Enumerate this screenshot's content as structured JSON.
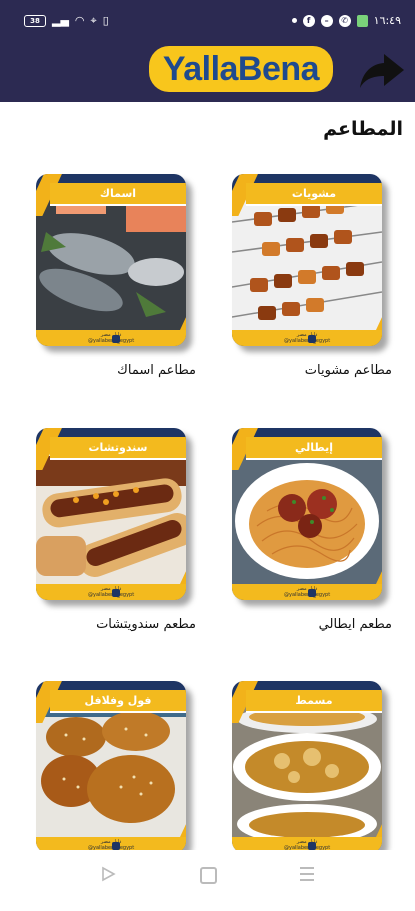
{
  "status_bar": {
    "time": "١٦:٤٩",
    "battery": "38"
  },
  "header": {
    "logo_text": "YallaBena",
    "back_icon": "share-arrow-icon"
  },
  "page": {
    "title": "المطاعم"
  },
  "cards": [
    {
      "banner": "مشويات",
      "label": "مطاعم مشويات",
      "photo": "grill"
    },
    {
      "banner": "اسماك",
      "label": "مطاعم اسماك",
      "photo": "fish"
    },
    {
      "banner": "إيطالي",
      "label": "مطعم ايطالي",
      "photo": "spaghetti"
    },
    {
      "banner": "سندوتشات",
      "label": "مطعم سندويتشات",
      "photo": "hotdog"
    },
    {
      "banner": "مسمط",
      "label": "",
      "photo": "stew"
    },
    {
      "banner": "فول وفلافل",
      "label": "",
      "photo": "falafel"
    }
  ],
  "card_footer": {
    "line1": "دليل مصر",
    "line2": "@yallabena_egypt"
  },
  "colors": {
    "header_bg": "#2c2a52",
    "logo_bg": "#f8c61c",
    "logo_text": "#1f4a8e",
    "banner_gold": "#f3ba1e",
    "tile_navy": "#1e3564"
  }
}
